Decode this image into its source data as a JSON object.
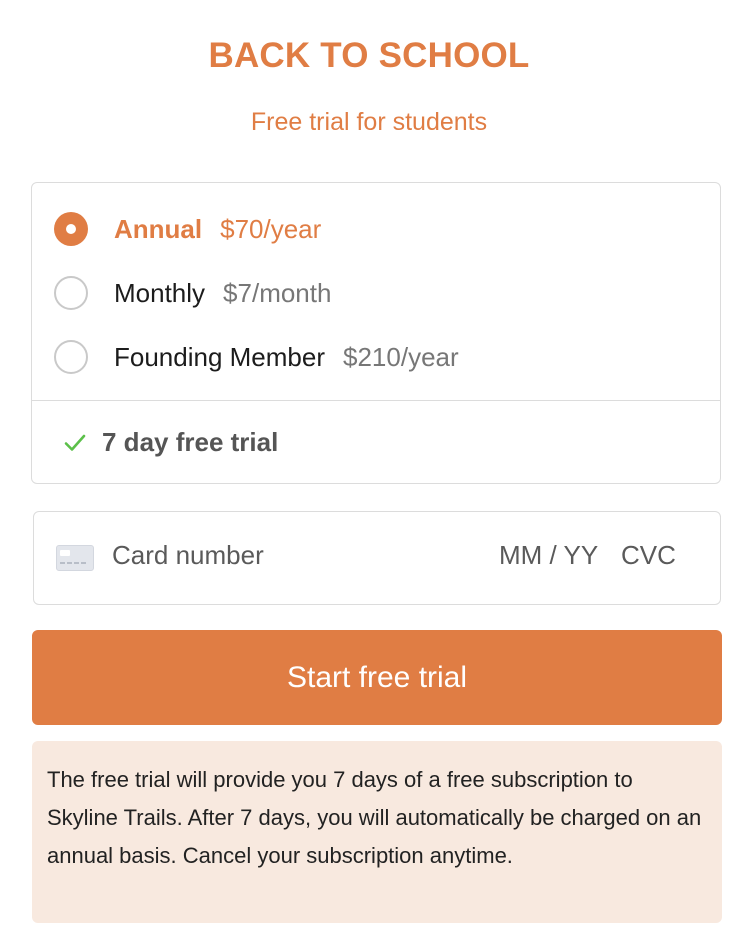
{
  "header": {
    "title": "BACK TO SCHOOL",
    "subtitle": "Free trial for students"
  },
  "plans": [
    {
      "name": "Annual",
      "price": "$70/year",
      "selected": true
    },
    {
      "name": "Monthly",
      "price": "$7/month",
      "selected": false
    },
    {
      "name": "Founding Member",
      "price": "$210/year",
      "selected": false
    }
  ],
  "trial": {
    "label": "7 day free trial",
    "icon": "check-icon"
  },
  "card": {
    "icon": "credit-card-icon",
    "number_placeholder": "Card number",
    "expiry_placeholder": "MM / YY",
    "cvc_placeholder": "CVC"
  },
  "cta": {
    "label": "Start free trial"
  },
  "notice": {
    "text": "The free trial will provide you 7 days of a free subscription to Skyline Trails. After 7 days, you will automatically be charged on an annual basis. Cancel your subscription anytime."
  },
  "colors": {
    "accent": "#e07d44",
    "notice_bg": "#f8e9df",
    "check": "#5cc04a"
  }
}
